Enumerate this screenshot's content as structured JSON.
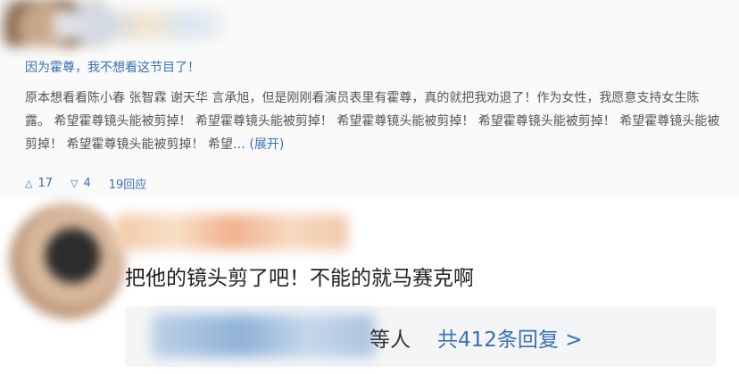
{
  "answer": {
    "title": "因为霍尊，我不想看这节目了！",
    "body": "原本想看看陈小春 张智霖 谢天华 言承旭，但是刚刚看演员表里有霍尊，真的就把我劝退了！作为女性，我愿意支持女生陈露。 希望霍尊镜头能被剪掉！ 希望霍尊镜头能被剪掉！ 希望霍尊镜头能被剪掉！ 希望霍尊镜头能被剪掉！ 希望霍尊镜头能被剪掉！ 希望霍尊镜头能被剪掉！ 希望…",
    "expand": "(展开)",
    "upvotes": "17",
    "downvotes": "4",
    "replies": "19回应"
  },
  "comment": {
    "text": "把他的镜头剪了吧！不能的就马赛克啊",
    "reply_etc": "等人",
    "reply_total": "共412条回复 >"
  }
}
